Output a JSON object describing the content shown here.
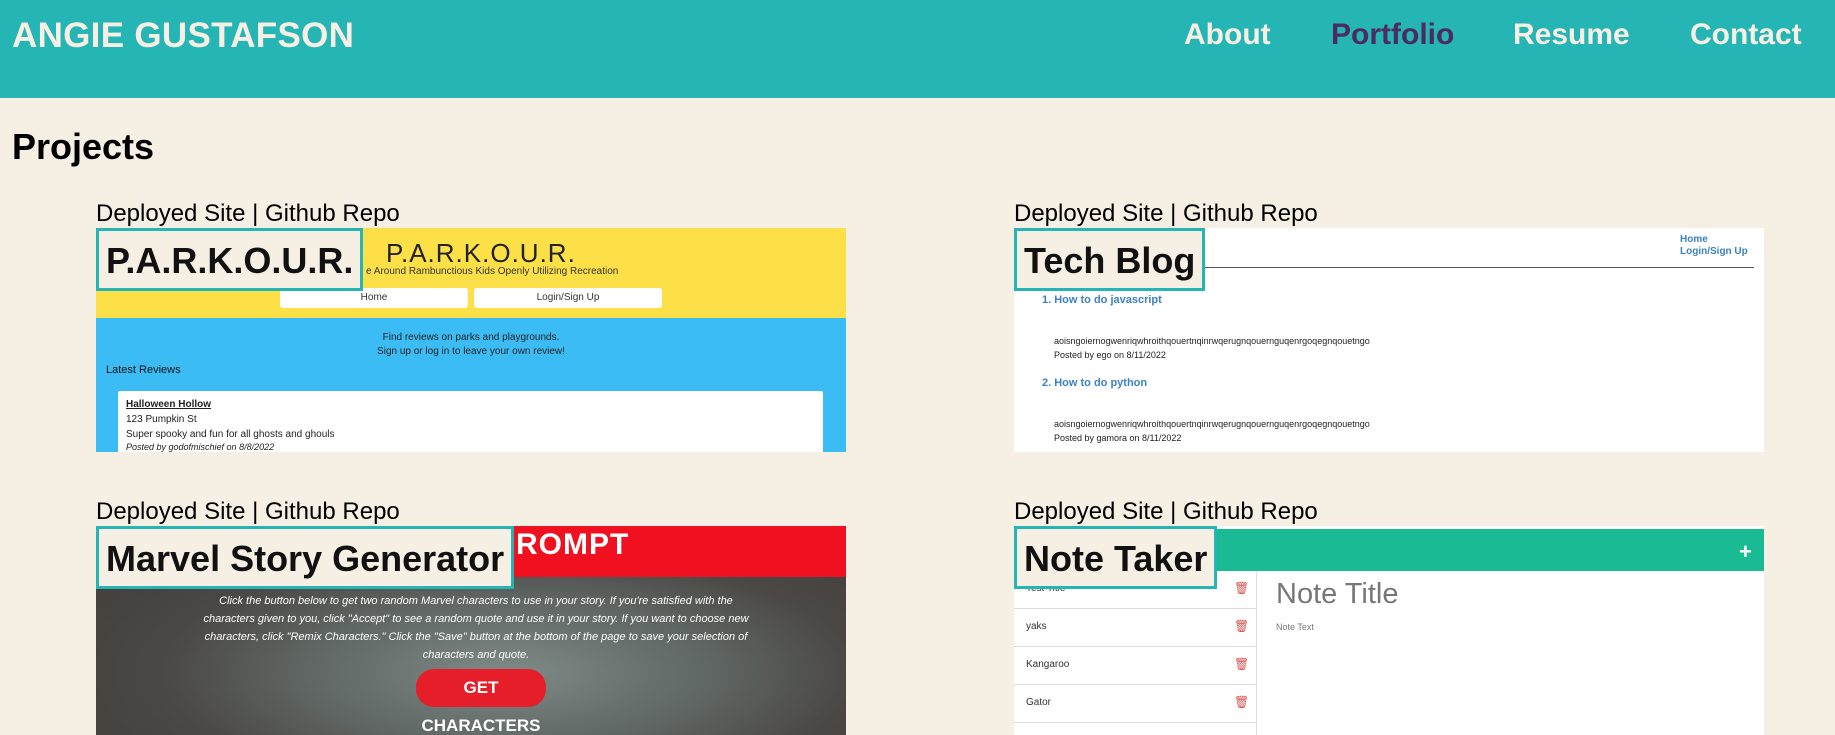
{
  "header": {
    "brand": "ANGIE GUSTAFSON",
    "nav": [
      "About",
      "Portfolio",
      "Resume",
      "Contact"
    ],
    "active": "Portfolio"
  },
  "projects_title": "Projects",
  "links": {
    "deployed": "Deployed Site",
    "sep": "|",
    "repo": "Github Repo"
  },
  "projects": [
    {
      "label": "P.A.R.K.O.U.R."
    },
    {
      "label": "Tech Blog"
    },
    {
      "label": "Marvel Story Generator"
    },
    {
      "label": "Note Taker"
    }
  ],
  "parkour": {
    "title": "P.A.R.K.O.U.R.",
    "subtitle": "e Around Rambunctious Kids Openly Utilizing Recreation",
    "home": "Home",
    "login": "Login/Sign Up",
    "find": "Find reviews on parks and playgrounds.",
    "signup": "Sign up or log in to leave your own review!",
    "latest": "Latest Reviews",
    "review_title": "Halloween Hollow",
    "review_addr": "123 Pumpkin St",
    "review_desc": "Super spooky and fun for all ghosts and ghouls",
    "review_meta": "Posted by godofmischief on 8/8/2022"
  },
  "techblog": {
    "nav_home": "Home",
    "nav_login": "Login/Sign Up",
    "post1": "How to do javascript",
    "post1_text": "aoisngoiernogwenriqwhroithqouertnqinrwqerugnqouernguqenrgoqegnqouetngo",
    "post1_meta": "Posted by ego on 8/11/2022",
    "post2": "How to do python",
    "post2_text": "aoisngoiernogwenriqwhroithqouertnqinrwqerugnqouernguqenrgoqegnqouetngo",
    "post2_meta": "Posted by gamora on 8/11/2022"
  },
  "marvel": {
    "prompt": "ROMPT",
    "text": "Click the button below to get two random Marvel characters to use in your story. If you're satisfied with the characters given to you, click \"Accept\" to see a random quote and use it in your story. If you want to choose new characters, click \"Remix Characters.\" Click the \"Save\" button at the bottom of the page to save your selection of characters and quote.",
    "button": "GET CHARACTERS"
  },
  "notetaker": {
    "plus": "+",
    "notes": [
      "Test Title",
      "yaks",
      "Kangaroo",
      "Gator"
    ],
    "note_title": "Note Title",
    "note_text": "Note Text"
  }
}
